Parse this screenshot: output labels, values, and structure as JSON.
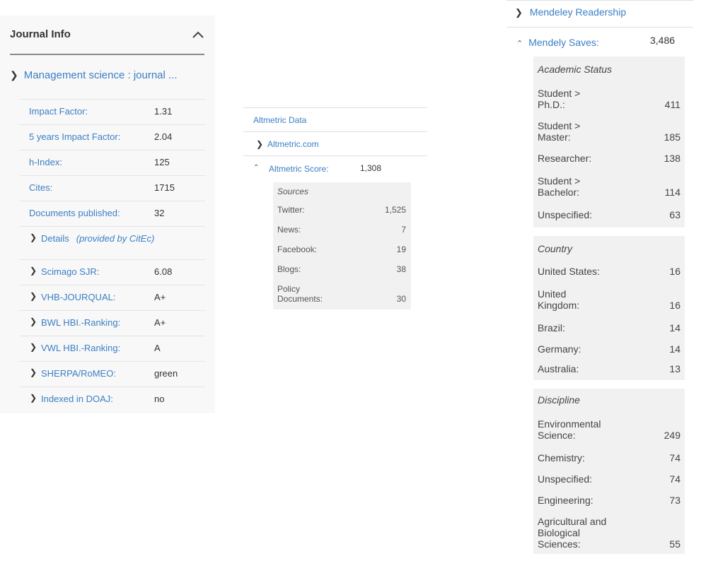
{
  "journal": {
    "title": "Journal Info",
    "series_link": "Management science : journal ...",
    "metrics": [
      {
        "label": "Impact Factor:",
        "value": "1.31"
      },
      {
        "label": "5 years Impact Factor:",
        "value": "2.04"
      },
      {
        "label": "h-Index:",
        "value": "125"
      },
      {
        "label": "Cites:",
        "value": "1715"
      },
      {
        "label": "Documents published:",
        "value": "32"
      }
    ],
    "details": {
      "label": "Details",
      "note": "(provided by CitEc)"
    },
    "rankings": [
      {
        "label": "Scimago SJR:",
        "value": "6.08"
      },
      {
        "label": "VHB-JOURQUAL:",
        "value": "A+"
      },
      {
        "label": "BWL HBI.-Ranking:",
        "value": "A+"
      },
      {
        "label": "VWL HBI.-Ranking:",
        "value": "A"
      },
      {
        "label": "SHERPA/RoMEO:",
        "value": "green"
      },
      {
        "label": "Indexed in DOAJ:",
        "value": "no"
      }
    ]
  },
  "altmetric": {
    "header": "Altmetric Data",
    "source_link": "Altmetric.com",
    "score_label": "Altmetric Score:",
    "score_value": "1,308",
    "sources_title": "Sources",
    "sources": [
      {
        "label": "Twitter:",
        "value": "1,525"
      },
      {
        "label": "News:",
        "value": "7"
      },
      {
        "label": "Facebook:",
        "value": "19"
      },
      {
        "label": "Blogs:",
        "value": "38"
      },
      {
        "label_line1": "Policy",
        "label_line2": "Documents:",
        "value": "30"
      }
    ]
  },
  "mendeley": {
    "readership_label": "Mendeley Readership",
    "saves_label": "Mendely Saves:",
    "saves_value": "3,486",
    "academic": {
      "title": "Academic Status",
      "rows": [
        {
          "line1": "Student >",
          "line2": "Ph.D.:",
          "value": "411"
        },
        {
          "line1": "Student >",
          "line2": "Master:",
          "value": "185"
        },
        {
          "line1": "",
          "line2": "Researcher:",
          "value": "138"
        },
        {
          "line1": "Student >",
          "line2": "Bachelor:",
          "value": "114"
        },
        {
          "line1": "",
          "line2": "Unspecified:",
          "value": "63"
        }
      ]
    },
    "country": {
      "title": "Country",
      "rows": [
        {
          "line1": "",
          "line2": "United States:",
          "value": "16"
        },
        {
          "line1": "United",
          "line2": "Kingdom:",
          "value": "16"
        },
        {
          "line1": "",
          "line2": "Brazil:",
          "value": "14"
        },
        {
          "line1": "",
          "line2": "Germany:",
          "value": "14"
        },
        {
          "line1": "",
          "line2": "Australia:",
          "value": "13"
        }
      ]
    },
    "discipline": {
      "title": "Discipline",
      "rows": [
        {
          "line1": "Environmental",
          "line2": "Science:",
          "value": "249"
        },
        {
          "line1": "",
          "line2": "Chemistry:",
          "value": "74"
        },
        {
          "line1": "",
          "line2": "Unspecified:",
          "value": "74"
        },
        {
          "line1": "",
          "line2": "Engineering:",
          "value": "73"
        },
        {
          "line0": "Agricultural and",
          "line1": "Biological",
          "line2": "Sciences:",
          "value": "55"
        }
      ]
    }
  }
}
